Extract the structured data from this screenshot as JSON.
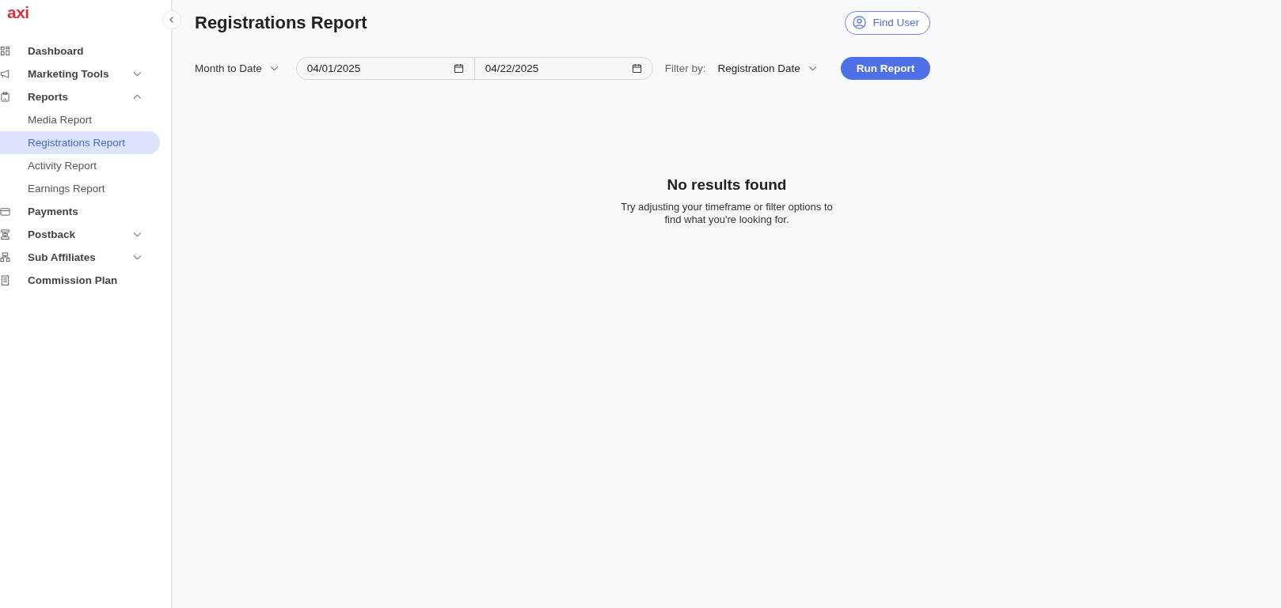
{
  "logo": "axi",
  "sidebar": {
    "items": [
      {
        "label": "Dashboard"
      },
      {
        "label": "Marketing Tools",
        "expanded": false
      },
      {
        "label": "Reports",
        "expanded": true,
        "children": [
          {
            "label": "Media Report",
            "selected": false
          },
          {
            "label": "Registrations Report",
            "selected": true
          },
          {
            "label": "Activity Report",
            "selected": false
          },
          {
            "label": "Earnings Report",
            "selected": false
          }
        ]
      },
      {
        "label": "Payments"
      },
      {
        "label": "Postback",
        "expanded": false
      },
      {
        "label": "Sub Affiliates",
        "expanded": false
      },
      {
        "label": "Commission Plan"
      }
    ]
  },
  "page": {
    "title": "Registrations Report",
    "find_user": "Find User"
  },
  "filters": {
    "period": "Month to Date",
    "start_date": "04/01/2025",
    "end_date": "04/22/2025",
    "filter_label": "Filter by:",
    "filter_value": "Registration Date",
    "run": "Run Report"
  },
  "empty_state": {
    "title": "No results found",
    "message": "Try adjusting your timeframe or filter options to find what you're looking for."
  }
}
